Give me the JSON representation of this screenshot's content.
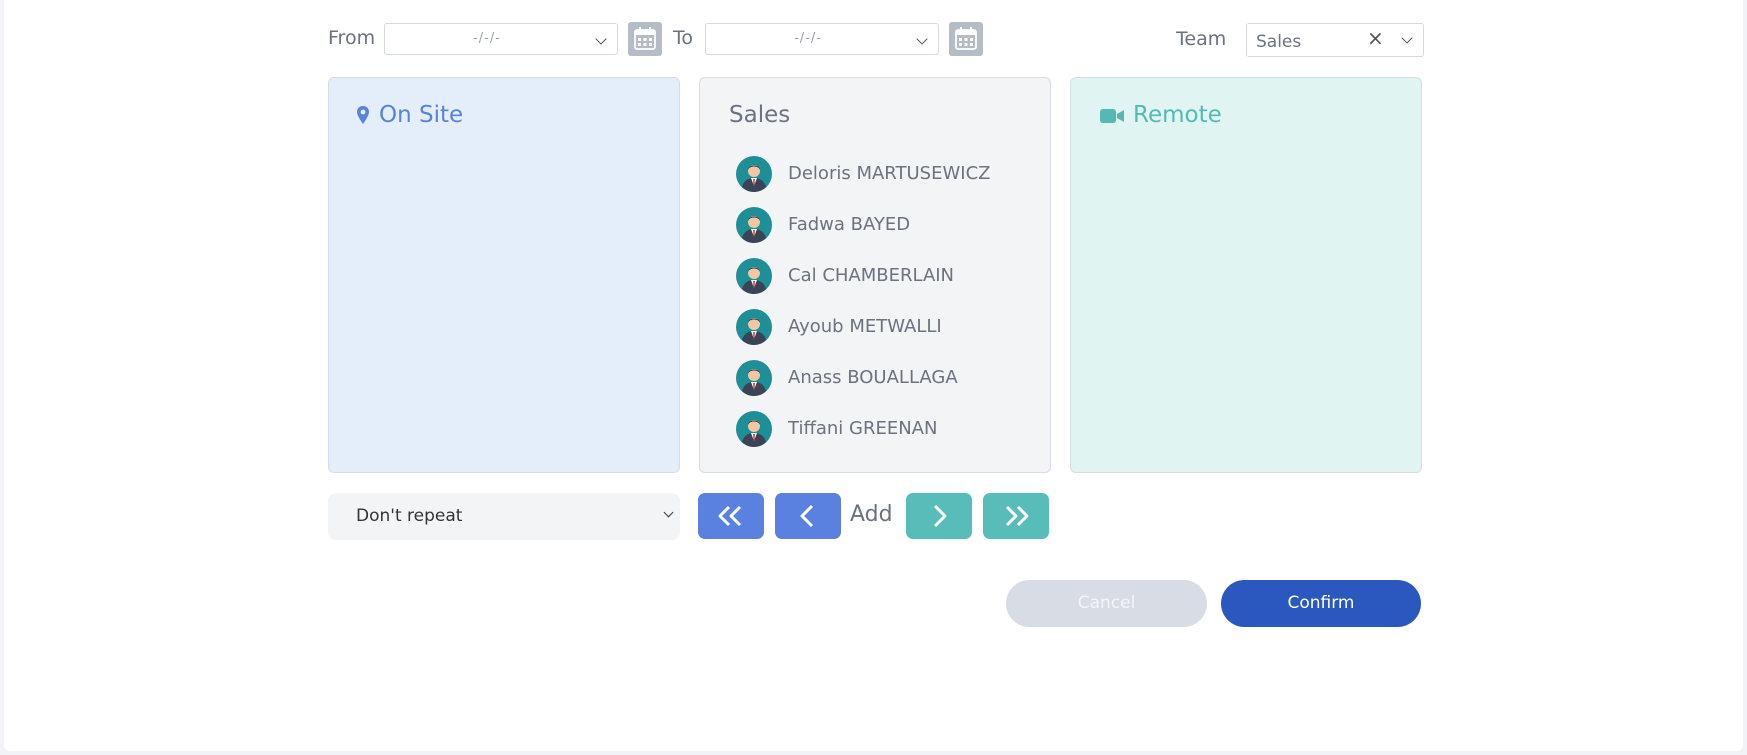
{
  "filters": {
    "from_label": "From",
    "from_value": "-/-/-",
    "to_label": "To",
    "to_value": "-/-/-",
    "team_label": "Team",
    "team_value": "Sales"
  },
  "panels": {
    "onsite_title": "On Site",
    "team_title": "Sales",
    "remote_title": "Remote"
  },
  "members": [
    {
      "name": "Deloris MARTUSEWICZ"
    },
    {
      "name": "Fadwa BAYED"
    },
    {
      "name": "Cal CHAMBERLAIN"
    },
    {
      "name": "Ayoub METWALLI"
    },
    {
      "name": "Anass BOUALLAGA"
    },
    {
      "name": "Tiffani GREENAN"
    }
  ],
  "repeat": {
    "selected": "Don't repeat"
  },
  "controls": {
    "add_label": "Add"
  },
  "actions": {
    "cancel_label": "Cancel",
    "confirm_label": "Confirm"
  },
  "colors": {
    "onsite_accent": "#5b82d9",
    "remote_accent": "#54b9b3",
    "confirm_bg": "#2a58be",
    "cancel_bg": "#d7dce5"
  },
  "icons": {
    "onsite": "map-pin-icon",
    "remote": "video-camera-icon",
    "calendar": "calendar-icon"
  }
}
